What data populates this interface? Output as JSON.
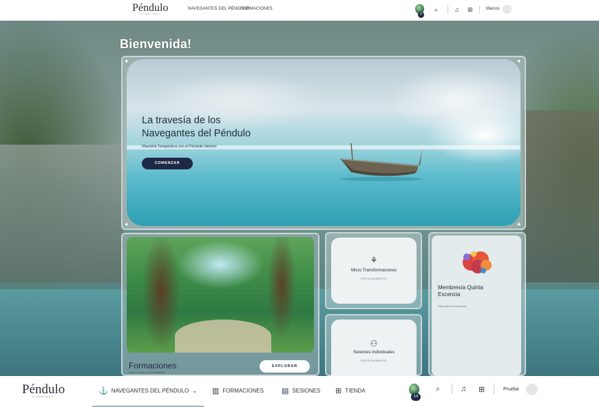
{
  "top_nav": {
    "logo": "Péndulo",
    "logo_tagline": "el camino interior",
    "nav_items": [
      {
        "label": "NAVEGANTES DEL PÉNDULO",
        "has_dropdown": true
      },
      {
        "label": "FORMACIONES"
      }
    ],
    "gem_count": "0",
    "user_name": "Marcos"
  },
  "welcome": "Bienvenida!",
  "hero": {
    "title_line1": "La travesía de los",
    "title_line2": "Navegantes del Péndulo",
    "subtitle": "Maestría Terapéutica con el Péndulo Hebreo",
    "button": "COMENZAR"
  },
  "formaciones": {
    "title": "Formaciones",
    "subtitle": "Explora cursos y formaciones",
    "button": "EXPLORAR"
  },
  "micro": {
    "title": "Micro Transformaciones",
    "status": "PRÓXIMAMENTE"
  },
  "sesiones": {
    "title": "Sesiones Individuales",
    "status": "PRÓXIMAMENTE"
  },
  "membresia": {
    "title_line1": "Membresía Quinta",
    "title_line2": "Escencia",
    "subtitle": "Disponible en Diciembre"
  },
  "bottom_nav": {
    "logo": "Péndulo",
    "logo_tagline": "el camino interior",
    "items": [
      {
        "label": "NAVEGANTES DEL PÉNDULO",
        "icon": "anchor-icon",
        "has_dropdown": true
      },
      {
        "label": "FORMACIONES",
        "icon": "book-icon"
      },
      {
        "label": "SESIONES",
        "icon": "calendar-icon"
      },
      {
        "label": "TIENDA",
        "icon": "cart-icon"
      }
    ],
    "gem_count": "14",
    "user_name": "Prueba"
  },
  "colors": {
    "primary_dark": "#1d2945",
    "panel_border": "#c9d6d8",
    "background": "#7a8f8a"
  }
}
